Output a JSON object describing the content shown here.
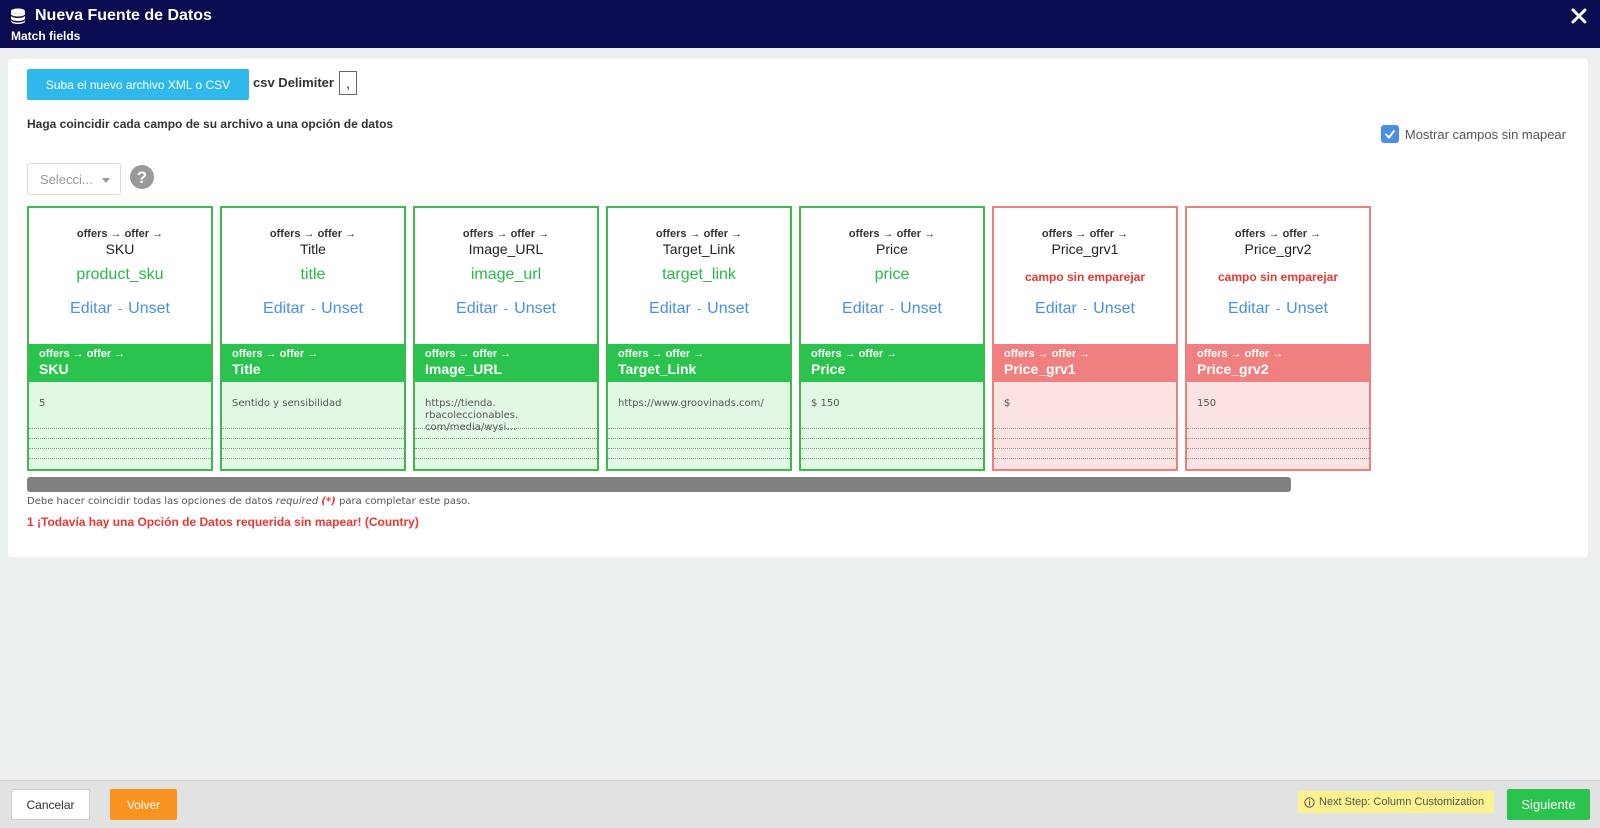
{
  "header": {
    "title": "Nueva Fuente de Datos",
    "subtitle": "Match fields"
  },
  "toolbar": {
    "upload_label": "Suba el nuevo archivo XML o CSV",
    "delimiter_label": "csv Delimiter",
    "delimiter_value": ","
  },
  "instructions": "Haga coincidir cada campo de su archivo a una opción de datos",
  "show_unmapped": {
    "label": "Mostrar campos sin mapear",
    "checked": true
  },
  "select": {
    "placeholder": "Selecci..."
  },
  "actions": {
    "edit": "Editar",
    "unset": "Unset",
    "separator": "-"
  },
  "fields": [
    {
      "path": "offers → offer →",
      "name": "SKU",
      "mapped": "product_sku",
      "matched": true,
      "sample": "5"
    },
    {
      "path": "offers → offer →",
      "name": "Title",
      "mapped": "title",
      "matched": true,
      "sample": "Sentido y sensibilidad"
    },
    {
      "path": "offers → offer →",
      "name": "Image_URL",
      "mapped": "image_url",
      "matched": true,
      "sample": "https://tienda.\nrbacoleccionables.\ncom/media/wysi…"
    },
    {
      "path": "offers → offer →",
      "name": "Target_Link",
      "mapped": "target_link",
      "matched": true,
      "sample": "https://www.groovinads.com/"
    },
    {
      "path": "offers → offer →",
      "name": "Price",
      "mapped": "price",
      "matched": true,
      "sample": "$ 150"
    },
    {
      "path": "offers → offer →",
      "name": "Price_grv1",
      "mapped": "campo sin emparejar",
      "matched": false,
      "sample": "$"
    },
    {
      "path": "offers → offer →",
      "name": "Price_grv2",
      "mapped": "campo sin emparejar",
      "matched": false,
      "sample": "150"
    }
  ],
  "note": {
    "prefix": "Debe hacer coincidir todas las opciones de datos",
    "required": "required",
    "star": "(*)",
    "suffix": "para completar este paso."
  },
  "error": "1 ¡Todavía hay una Opción de Datos requerida sin mapear! (Country)",
  "footer": {
    "cancel": "Cancelar",
    "back": "Volver",
    "next_hint": "Next Step: Column Customization",
    "next": "Siguiente"
  },
  "colors": {
    "header_bg": "#0b0b52",
    "matched": "#2ac34d",
    "unmatched": "#f08080",
    "link": "#4a90e2",
    "error": "#e53935",
    "upload": "#2eb8ec",
    "back": "#f7931e"
  }
}
